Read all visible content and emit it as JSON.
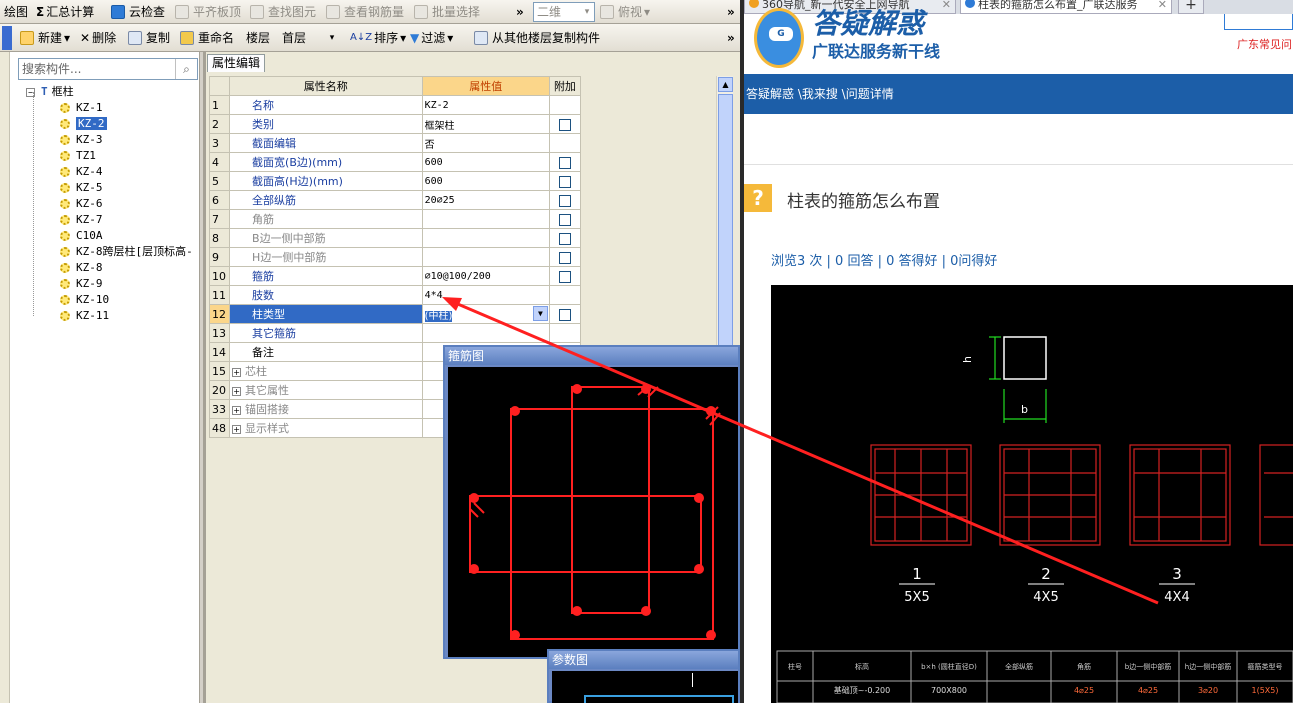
{
  "toolbar1": {
    "draw": "绘图",
    "sum": "汇总计算",
    "cloud_check": "云检查",
    "flat_roof": "平齐板顶",
    "find_elem": "查找图元",
    "view_rebar": "查看钢筋量",
    "batch_select": "批量选择",
    "view_mode": "二维",
    "overview": "俯视",
    "more": "»"
  },
  "toolbar2": {
    "new": "新建",
    "delete": "删除",
    "copy": "复制",
    "rename": "重命名",
    "floor_label": "楼层",
    "floor_value": "首层",
    "sort": "排序",
    "filter": "过滤",
    "copy_from_floor": "从其他楼层复制构件",
    "more": "»"
  },
  "search": {
    "placeholder": "搜索构件..."
  },
  "tree": {
    "root": "框柱",
    "items": [
      "KZ-1",
      "KZ-2",
      "KZ-3",
      "TZ1",
      "KZ-4",
      "KZ-5",
      "KZ-6",
      "KZ-7",
      "C10A",
      "KZ-8跨层柱[层顶标高-",
      "KZ-8",
      "KZ-9",
      "KZ-10",
      "KZ-11"
    ],
    "selected": "KZ-2"
  },
  "props": {
    "tab": "属性编辑",
    "col_name": "属性名称",
    "col_value": "属性值",
    "col_extra": "附加",
    "rows": [
      {
        "n": "1",
        "k": "名称",
        "v": "KZ-2"
      },
      {
        "n": "2",
        "k": "类别",
        "v": "框架柱"
      },
      {
        "n": "3",
        "k": "截面编辑",
        "v": "否"
      },
      {
        "n": "4",
        "k": "截面宽(B边)(mm)",
        "v": "600"
      },
      {
        "n": "5",
        "k": "截面高(H边)(mm)",
        "v": "600"
      },
      {
        "n": "6",
        "k": "全部纵筋",
        "v": "20⌀25"
      },
      {
        "n": "7",
        "k": "角筋",
        "v": ""
      },
      {
        "n": "8",
        "k": "B边一侧中部筋",
        "v": ""
      },
      {
        "n": "9",
        "k": "H边一侧中部筋",
        "v": ""
      },
      {
        "n": "10",
        "k": "箍筋",
        "v": "⌀10@100/200"
      },
      {
        "n": "11",
        "k": "肢数",
        "v": "4*4"
      },
      {
        "n": "12",
        "k": "柱类型",
        "v": "(中柱)"
      },
      {
        "n": "13",
        "k": "其它箍筋",
        "v": ""
      },
      {
        "n": "14",
        "k": "备注",
        "v": ""
      },
      {
        "n": "15",
        "k": "芯柱",
        "v": ""
      },
      {
        "n": "20",
        "k": "其它属性",
        "v": ""
      },
      {
        "n": "33",
        "k": "锚固搭接",
        "v": ""
      },
      {
        "n": "48",
        "k": "显示样式",
        "v": ""
      }
    ]
  },
  "popups": {
    "stirrup": "箍筋图",
    "params": "参数图"
  },
  "browser": {
    "tab1": "360导航_新一代安全上网导航",
    "tab2": "柱表的箍筋怎么布置_广联达服务",
    "banner_title": "答疑解惑",
    "banner_sub": "广联达服务新干线",
    "banner_right": "广东常见问",
    "breadcrumb": "答疑解惑 \\我来搜 \\问题详情",
    "q_icon": "?",
    "question": "柱表的箍筋怎么布置",
    "stats": "浏览3 次 | 0 回答 | 0 答得好 | 0问得好"
  },
  "cad": {
    "dim_h": "h",
    "dim_b": "b",
    "labels": [
      {
        "num": "1",
        "den": "5X5"
      },
      {
        "num": "2",
        "den": "4X5"
      },
      {
        "num": "3",
        "den": "4X4"
      }
    ],
    "table_headers": [
      "柱号",
      "标高",
      "b×h (圆柱直径D)",
      "全部纵筋",
      "角筋",
      "b边一侧中部筋",
      "h边一侧中部筋",
      "箍筋类型号"
    ],
    "table_row": [
      "",
      "基础顶~-0.200",
      "700X800",
      "",
      "4⌀25",
      "4⌀25",
      "3⌀20",
      "1(5X5)"
    ]
  },
  "colors": {
    "accent_red": "#ff2020",
    "cad_red": "#d42222",
    "blue_bar": "#1c5ea8",
    "selection": "#316ac5"
  }
}
